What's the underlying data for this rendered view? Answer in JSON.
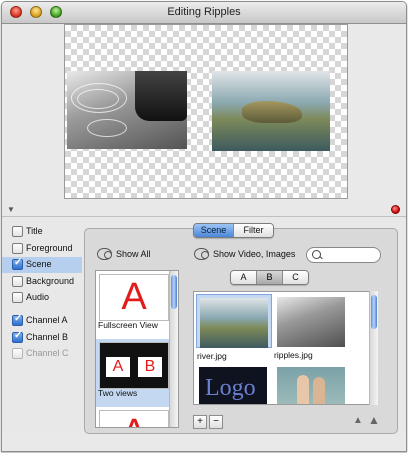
{
  "window": {
    "title": "Editing Ripples"
  },
  "left_checks": [
    {
      "label": "Title",
      "checked": false,
      "selected": false,
      "enabled": true
    },
    {
      "label": "Foreground",
      "checked": false,
      "selected": false,
      "enabled": true
    },
    {
      "label": "Scene",
      "checked": true,
      "selected": true,
      "enabled": true
    },
    {
      "label": "Background",
      "checked": false,
      "selected": false,
      "enabled": true
    },
    {
      "label": "Audio",
      "checked": false,
      "selected": false,
      "enabled": true
    },
    {
      "label": "Channel A",
      "checked": true,
      "selected": false,
      "enabled": true
    },
    {
      "label": "Channel B",
      "checked": true,
      "selected": false,
      "enabled": true
    },
    {
      "label": "Channel C",
      "checked": false,
      "selected": false,
      "enabled": false
    }
  ],
  "tabs": [
    {
      "label": "Scene",
      "active": true
    },
    {
      "label": "Filter",
      "active": false
    }
  ],
  "toolbar": {
    "show_all": "Show All",
    "show_media": "Show Video, Images",
    "search_placeholder": ""
  },
  "channels": [
    {
      "label": "A",
      "active": false
    },
    {
      "label": "B",
      "active": true
    },
    {
      "label": "C",
      "active": false
    }
  ],
  "scene_list": [
    {
      "caption": "Fullscreen View",
      "glyph": "A",
      "selected": false
    },
    {
      "caption": "Two views",
      "glyph_left": "A",
      "glyph_right": "B",
      "selected": true
    },
    {
      "caption": "",
      "glyph": "A",
      "selected": false
    }
  ],
  "media": [
    {
      "caption": "river.jpg",
      "selected": true
    },
    {
      "caption": "ripples.jpg",
      "selected": false
    },
    {
      "caption": "",
      "logo_text": "Logo",
      "selected": false
    },
    {
      "caption": "",
      "selected": false
    }
  ],
  "buttons": {
    "add": "+",
    "remove": "−"
  }
}
